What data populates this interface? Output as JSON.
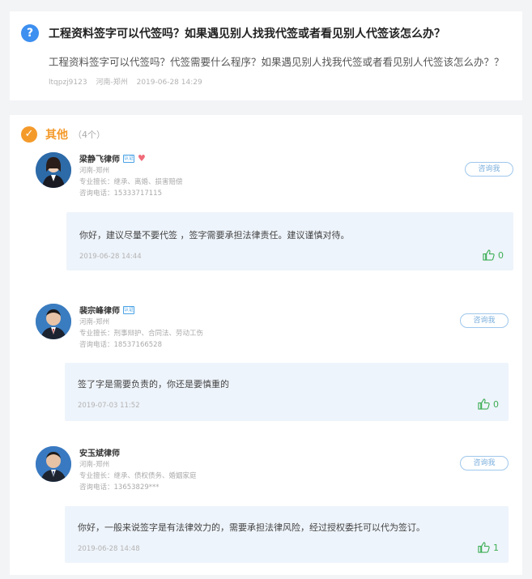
{
  "question": {
    "icon": "question-icon",
    "icon_glyph": "?",
    "title": "工程资料签字可以代签吗？如果遇见别人找我代签或者看见别人代签该怎么办？",
    "body": "工程资料签字可以代签吗？代签需要什么程序？如果遇见别人找我代签或者看见别人代签该怎么办？？",
    "user": "ltqpzj9123",
    "location": "河南-郑州",
    "time": "2019-06-28 14:29"
  },
  "section": {
    "title": "其他",
    "count": "（4个）",
    "icon_glyph": "✓"
  },
  "answers": [
    {
      "name": "梁静飞律师",
      "badge": "认证",
      "location": "河南-郑州",
      "specialty": "专业擅长：继承、离婚、损害赔偿",
      "phone": "咨询电话：15333717115",
      "consult_label": "咨询我",
      "reply": "你好，建议尽量不要代签 ，签字需要承担法律责任。建议谨慎对待。",
      "time": "2019-06-28 14:44",
      "likes": "0"
    },
    {
      "name": "裴宗峰律师",
      "badge": "认证",
      "location": "河南-郑州",
      "specialty": "专业擅长：刑事辩护、合同法、劳动工伤",
      "phone": "咨询电话：18537166528",
      "consult_label": "咨询我",
      "reply": "签了字是需要负责的，你还是要慎重的",
      "time": "2019-07-03 11:52",
      "likes": "0"
    },
    {
      "name": "安玉斌律师",
      "badge": "",
      "location": "河南-郑州",
      "specialty": "专业擅长：继承、债权债务、婚姻家庭",
      "phone": "咨询电话：13653829***",
      "consult_label": "咨询我",
      "reply": "你好，一般来说签字是有法律效力的，需要承担法律风险，经过授权委托可以代为签订。",
      "time": "2019-06-28 14:48",
      "likes": "1"
    }
  ],
  "colors": {
    "accent_blue": "#3d8ff0",
    "accent_orange": "#f49a2b",
    "like_green": "#3dae55",
    "reply_bg": "#eef4fb"
  }
}
